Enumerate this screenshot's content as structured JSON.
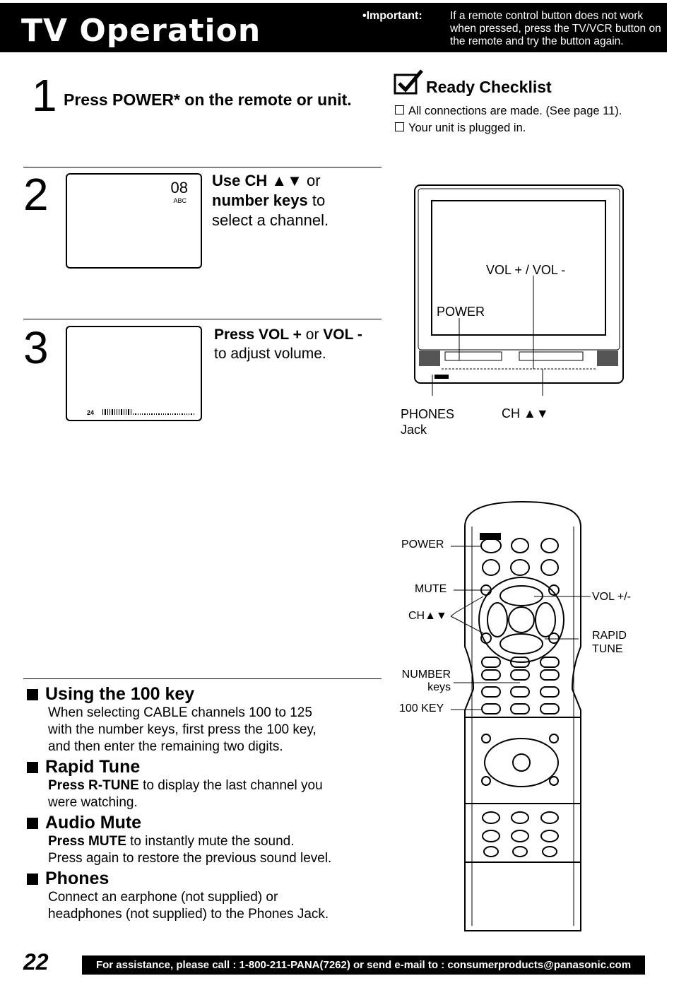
{
  "header": {
    "title": "TV Operation",
    "important_label": "•Important:",
    "important_text": "If a remote control button does not work when pressed, press the TV/VCR button on the remote and try the button again."
  },
  "step1": {
    "number": "1",
    "text": "Press POWER* on the remote or unit."
  },
  "checklist": {
    "title": "Ready Checklist",
    "items": [
      "All connections are made. (See page 11).",
      "Your unit is plugged in."
    ]
  },
  "step2": {
    "number": "2",
    "screen_channel": "08",
    "screen_station": "ABC",
    "text_bold1": "Use CH ▲▼",
    "text_plain1": " or",
    "text_bold2": "number keys",
    "text_plain2": " to",
    "text_plain3": "select a channel."
  },
  "step3": {
    "number": "3",
    "screen_volume": "24",
    "volume_level_fraction": 0.32,
    "text_bold1": "Press VOL +",
    "text_plain1": " or ",
    "text_bold2": "VOL -",
    "text_plain2": "to adjust volume."
  },
  "tv_diagram": {
    "vol_label": "VOL + / VOL -",
    "power_label": "POWER",
    "phones_label": "PHONES",
    "phones_label2": "Jack",
    "ch_label": "CH ▲▼"
  },
  "remote_diagram": {
    "power": "POWER",
    "mute": "MUTE",
    "ch": "CH▲▼",
    "vol": "VOL +/-",
    "rapid": "RAPID",
    "tune": "TUNE",
    "number": "NUMBER",
    "keys": "keys",
    "key100": "100 KEY"
  },
  "sections": [
    {
      "title": "Using the 100 key",
      "lines": [
        {
          "bold": "",
          "text": "When selecting CABLE channels 100 to 125"
        },
        {
          "bold": "",
          "text": "with the number keys, first press the 100 key,"
        },
        {
          "bold": "",
          "text": "and then enter the remaining two digits."
        }
      ]
    },
    {
      "title": "Rapid Tune",
      "lines": [
        {
          "bold": "Press R-TUNE",
          "text": " to display the last channel you"
        },
        {
          "bold": "",
          "text": "were watching."
        }
      ]
    },
    {
      "title": "Audio Mute",
      "lines": [
        {
          "bold": "Press MUTE",
          "text": " to instantly mute the sound."
        },
        {
          "bold": "",
          "text": "Press again to restore the previous sound level."
        }
      ]
    },
    {
      "title": "Phones",
      "lines": [
        {
          "bold": "",
          "text": "Connect an earphone (not supplied) or"
        },
        {
          "bold": "",
          "text": "headphones (not supplied) to the Phones Jack."
        }
      ]
    }
  ],
  "footer": {
    "page_number": "22",
    "assistance": "For assistance, please call : 1-800-211-PANA(7262) or send e-mail to : consumerproducts@panasonic.com"
  }
}
